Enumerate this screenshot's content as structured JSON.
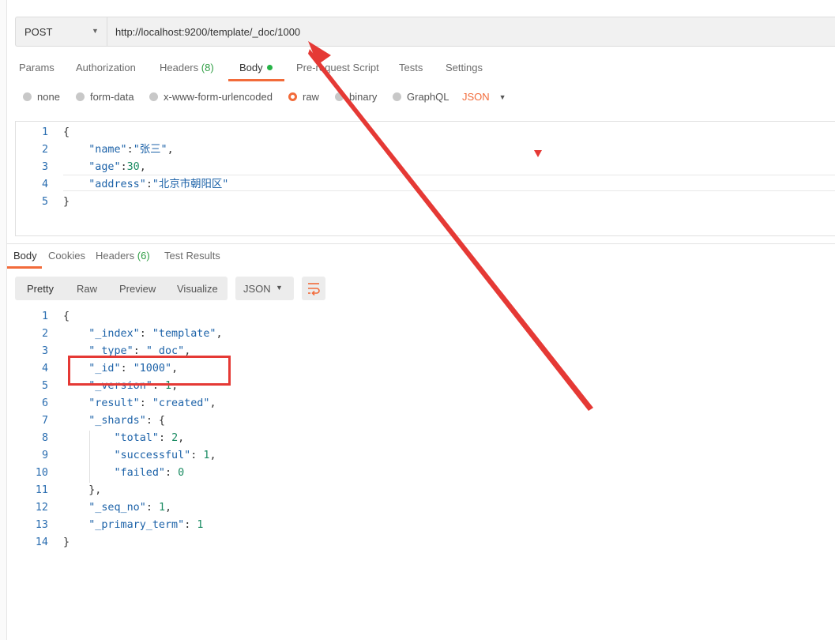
{
  "request": {
    "method": "POST",
    "url": "http://localhost:9200/template/_doc/1000"
  },
  "tabs": [
    {
      "label": "Params"
    },
    {
      "label": "Authorization"
    },
    {
      "label": "Headers",
      "count": "(8)"
    },
    {
      "label": "Body",
      "active": true
    },
    {
      "label": "Pre-request Script"
    },
    {
      "label": "Tests"
    },
    {
      "label": "Settings"
    }
  ],
  "body_types": [
    "none",
    "form-data",
    "x-www-form-urlencoded",
    "raw",
    "binary",
    "GraphQL"
  ],
  "body_type_selected": "raw",
  "body_format": "JSON",
  "request_body": {
    "line_numbers": [
      "1",
      "2",
      "3",
      "4",
      "5"
    ]
  },
  "response_tabs": [
    {
      "label": "Body",
      "active": true
    },
    {
      "label": "Cookies"
    },
    {
      "label": "Headers",
      "count": "(6)"
    },
    {
      "label": "Test Results"
    }
  ],
  "view_modes": [
    "Pretty",
    "Raw",
    "Preview",
    "Visualize"
  ],
  "response_format": "JSON",
  "response_body": {
    "line_numbers": [
      "1",
      "2",
      "3",
      "4",
      "5",
      "6",
      "7",
      "8",
      "9",
      "10",
      "11",
      "12",
      "13",
      "14"
    ]
  },
  "colors": {
    "accent": "#f26b3a",
    "annotation": "#e53935",
    "status_green": "#26b347"
  },
  "icons": {
    "method_dropdown": "chevron-down-icon",
    "wrap": "wrap-lines-icon"
  }
}
